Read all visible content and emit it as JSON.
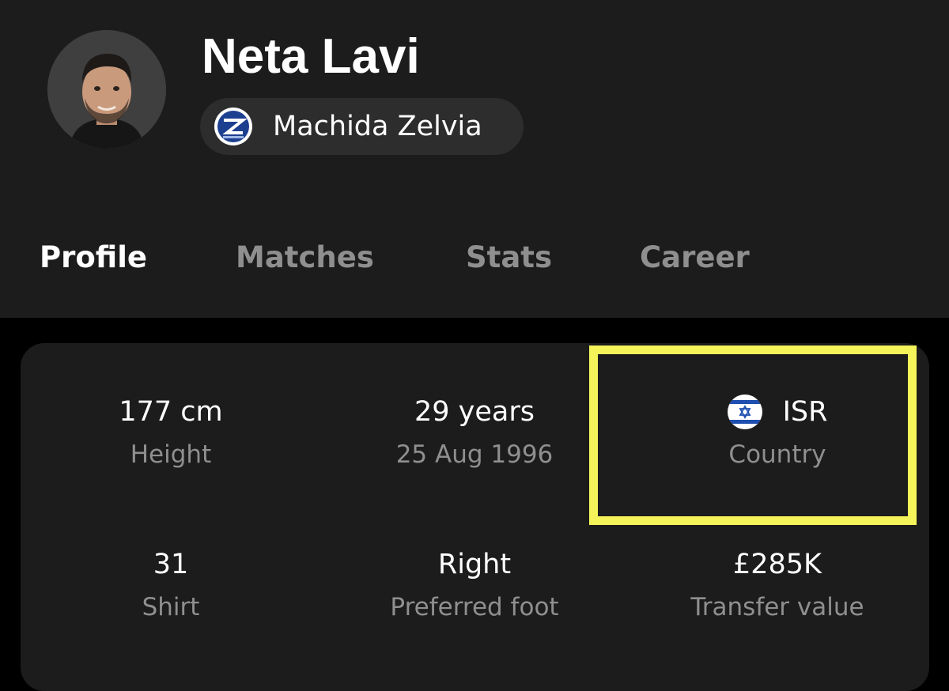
{
  "player": {
    "name": "Neta Lavi",
    "avatar_icon": "player-portrait"
  },
  "team": {
    "name": "Machida Zelvia",
    "logo_icon": "club-crest-icon",
    "logo_color": "#1d3f8f"
  },
  "tabs": [
    {
      "label": "Profile",
      "active": true
    },
    {
      "label": "Matches",
      "active": false
    },
    {
      "label": "Stats",
      "active": false
    },
    {
      "label": "Career",
      "active": false
    }
  ],
  "stats": {
    "height": {
      "value": "177 cm",
      "label": "Height"
    },
    "age": {
      "value": "29 years",
      "label": "25 Aug 1996"
    },
    "country": {
      "value": "ISR",
      "label": "Country",
      "flag_icon": "israel-flag-icon"
    },
    "shirt": {
      "value": "31",
      "label": "Shirt"
    },
    "foot": {
      "value": "Right",
      "label": "Preferred foot"
    },
    "transfer": {
      "value": "£285K",
      "label": "Transfer value"
    }
  },
  "colors": {
    "background": "#000000",
    "surface": "#1c1c1c",
    "chip": "#2d2d2d",
    "text_primary": "#ffffff",
    "text_secondary": "#8f8f8f",
    "highlight": "#f4f359"
  }
}
